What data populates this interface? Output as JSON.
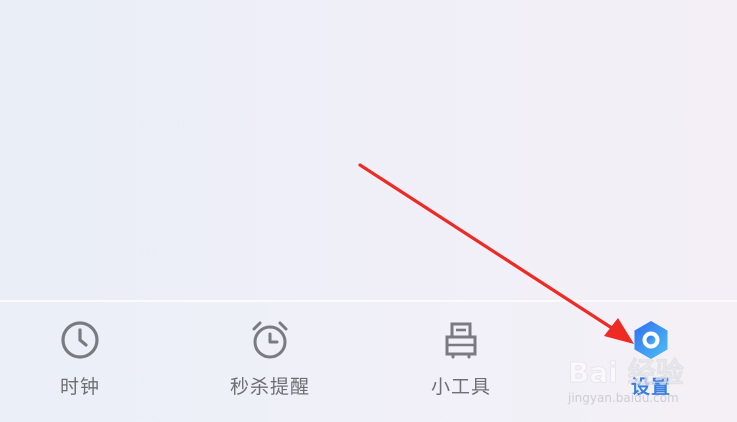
{
  "tabs": [
    {
      "label": "时钟",
      "icon": "clock-icon",
      "active": false
    },
    {
      "label": "秒杀提醒",
      "icon": "alarm-clock-icon",
      "active": false
    },
    {
      "label": "小工具",
      "icon": "tools-icon",
      "active": false
    },
    {
      "label": "设置",
      "icon": "settings-hexagon-icon",
      "active": true
    }
  ],
  "colors": {
    "inactive_icon": "#7a7b80",
    "inactive_label": "#6e6f73",
    "active_label": "#3a7fe0",
    "active_icon_start": "#2f6ff0",
    "active_icon_end": "#4fc0f4",
    "annotation_arrow": "#ee2a24"
  },
  "watermark": {
    "logo_text": "Bai 经验",
    "url_text": "jingyan.baidu.com"
  }
}
